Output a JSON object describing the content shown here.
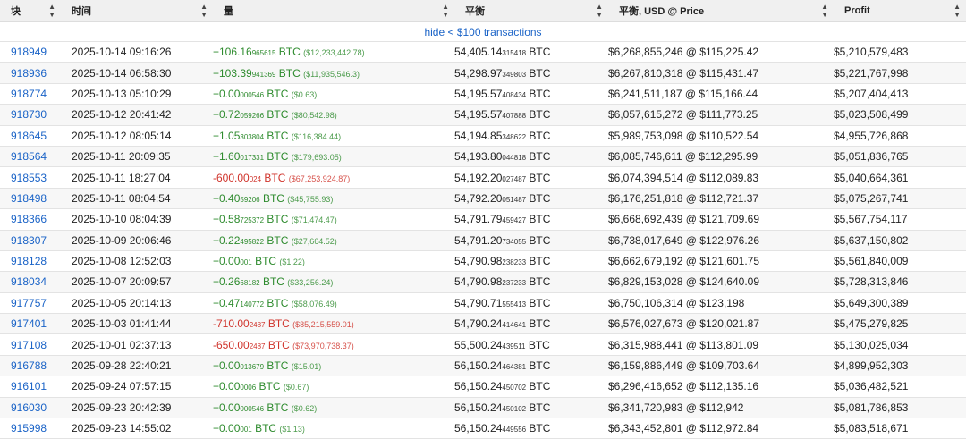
{
  "headers": [
    "块",
    "时间",
    "量",
    "平衡",
    "平衡, USD @ Price",
    "Profit"
  ],
  "toggle_label": "hide < $100 transactions",
  "colors": {
    "positive": "#2e8b2e",
    "negative": "#d0342c",
    "link": "#1a63c7"
  },
  "rows": [
    {
      "block": "918949",
      "time": "2025-10-14 09:16:26",
      "sign": "pos",
      "amt_main": "+106.16",
      "amt_small": "965615",
      "amt_unit": " BTC ",
      "amt_usd": "($12,233,442.78)",
      "bal_main": "54,405.14",
      "bal_small": "315418",
      "bal_unit": " BTC",
      "usd_price": "$6,268,855,246 @ $115,225.42",
      "profit": "$5,210,579,483"
    },
    {
      "block": "918936",
      "time": "2025-10-14 06:58:30",
      "sign": "pos",
      "amt_main": "+103.39",
      "amt_small": "941369",
      "amt_unit": " BTC ",
      "amt_usd": "($11,935,546.3)",
      "bal_main": "54,298.97",
      "bal_small": "349803",
      "bal_unit": " BTC",
      "usd_price": "$6,267,810,318 @ $115,431.47",
      "profit": "$5,221,767,998"
    },
    {
      "block": "918774",
      "time": "2025-10-13 05:10:29",
      "sign": "pos",
      "amt_main": "+0.00",
      "amt_small": "000546",
      "amt_unit": " BTC ",
      "amt_usd": "($0.63)",
      "bal_main": "54,195.57",
      "bal_small": "408434",
      "bal_unit": " BTC",
      "usd_price": "$6,241,511,187 @ $115,166.44",
      "profit": "$5,207,404,413"
    },
    {
      "block": "918730",
      "time": "2025-10-12 20:41:42",
      "sign": "pos",
      "amt_main": "+0.72",
      "amt_small": "059266",
      "amt_unit": " BTC ",
      "amt_usd": "($80,542.98)",
      "bal_main": "54,195.57",
      "bal_small": "407888",
      "bal_unit": " BTC",
      "usd_price": "$6,057,615,272 @ $111,773.25",
      "profit": "$5,023,508,499"
    },
    {
      "block": "918645",
      "time": "2025-10-12 08:05:14",
      "sign": "pos",
      "amt_main": "+1.05",
      "amt_small": "303804",
      "amt_unit": " BTC ",
      "amt_usd": "($116,384.44)",
      "bal_main": "54,194.85",
      "bal_small": "348622",
      "bal_unit": " BTC",
      "usd_price": "$5,989,753,098 @ $110,522.54",
      "profit": "$4,955,726,868"
    },
    {
      "block": "918564",
      "time": "2025-10-11 20:09:35",
      "sign": "pos",
      "amt_main": "+1.60",
      "amt_small": "017331",
      "amt_unit": " BTC ",
      "amt_usd": "($179,693.05)",
      "bal_main": "54,193.80",
      "bal_small": "044818",
      "bal_unit": " BTC",
      "usd_price": "$6,085,746,611 @ $112,295.99",
      "profit": "$5,051,836,765"
    },
    {
      "block": "918553",
      "time": "2025-10-11 18:27:04",
      "sign": "neg",
      "amt_main": "-600.00",
      "amt_small": "024",
      "amt_unit": " BTC ",
      "amt_usd": "($67,253,924.87)",
      "bal_main": "54,192.20",
      "bal_small": "027487",
      "bal_unit": " BTC",
      "usd_price": "$6,074,394,514 @ $112,089.83",
      "profit": "$5,040,664,361"
    },
    {
      "block": "918498",
      "time": "2025-10-11 08:04:54",
      "sign": "pos",
      "amt_main": "+0.40",
      "amt_small": "59206",
      "amt_unit": " BTC ",
      "amt_usd": "($45,755.93)",
      "bal_main": "54,792.20",
      "bal_small": "051487",
      "bal_unit": " BTC",
      "usd_price": "$6,176,251,818 @ $112,721.37",
      "profit": "$5,075,267,741"
    },
    {
      "block": "918366",
      "time": "2025-10-10 08:04:39",
      "sign": "pos",
      "amt_main": "+0.58",
      "amt_small": "725372",
      "amt_unit": " BTC ",
      "amt_usd": "($71,474.47)",
      "bal_main": "54,791.79",
      "bal_small": "459427",
      "bal_unit": " BTC",
      "usd_price": "$6,668,692,439 @ $121,709.69",
      "profit": "$5,567,754,117"
    },
    {
      "block": "918307",
      "time": "2025-10-09 20:06:46",
      "sign": "pos",
      "amt_main": "+0.22",
      "amt_small": "495822",
      "amt_unit": " BTC ",
      "amt_usd": "($27,664.52)",
      "bal_main": "54,791.20",
      "bal_small": "734055",
      "bal_unit": " BTC",
      "usd_price": "$6,738,017,649 @ $122,976.26",
      "profit": "$5,637,150,802"
    },
    {
      "block": "918128",
      "time": "2025-10-08 12:52:03",
      "sign": "pos",
      "amt_main": "+0.00",
      "amt_small": "001",
      "amt_unit": " BTC ",
      "amt_usd": "($1.22)",
      "bal_main": "54,790.98",
      "bal_small": "238233",
      "bal_unit": " BTC",
      "usd_price": "$6,662,679,192 @ $121,601.75",
      "profit": "$5,561,840,009"
    },
    {
      "block": "918034",
      "time": "2025-10-07 20:09:57",
      "sign": "pos",
      "amt_main": "+0.26",
      "amt_small": "68182",
      "amt_unit": " BTC ",
      "amt_usd": "($33,256.24)",
      "bal_main": "54,790.98",
      "bal_small": "237233",
      "bal_unit": " BTC",
      "usd_price": "$6,829,153,028 @ $124,640.09",
      "profit": "$5,728,313,846"
    },
    {
      "block": "917757",
      "time": "2025-10-05 20:14:13",
      "sign": "pos",
      "amt_main": "+0.47",
      "amt_small": "140772",
      "amt_unit": " BTC ",
      "amt_usd": "($58,076.49)",
      "bal_main": "54,790.71",
      "bal_small": "555413",
      "bal_unit": " BTC",
      "usd_price": "$6,750,106,314 @ $123,198",
      "profit": "$5,649,300,389"
    },
    {
      "block": "917401",
      "time": "2025-10-03 01:41:44",
      "sign": "neg",
      "amt_main": "-710.00",
      "amt_small": "2487",
      "amt_unit": " BTC ",
      "amt_usd": "($85,215,559.01)",
      "bal_main": "54,790.24",
      "bal_small": "414641",
      "bal_unit": " BTC",
      "usd_price": "$6,576,027,673 @ $120,021.87",
      "profit": "$5,475,279,825"
    },
    {
      "block": "917108",
      "time": "2025-10-01 02:37:13",
      "sign": "neg",
      "amt_main": "-650.00",
      "amt_small": "2487",
      "amt_unit": " BTC ",
      "amt_usd": "($73,970,738.37)",
      "bal_main": "55,500.24",
      "bal_small": "439511",
      "bal_unit": " BTC",
      "usd_price": "$6,315,988,441 @ $113,801.09",
      "profit": "$5,130,025,034"
    },
    {
      "block": "916788",
      "time": "2025-09-28 22:40:21",
      "sign": "pos",
      "amt_main": "+0.00",
      "amt_small": "013679",
      "amt_unit": " BTC ",
      "amt_usd": "($15.01)",
      "bal_main": "56,150.24",
      "bal_small": "464381",
      "bal_unit": " BTC",
      "usd_price": "$6,159,886,449 @ $109,703.64",
      "profit": "$4,899,952,303"
    },
    {
      "block": "916101",
      "time": "2025-09-24 07:57:15",
      "sign": "pos",
      "amt_main": "+0.00",
      "amt_small": "0006",
      "amt_unit": " BTC ",
      "amt_usd": "($0.67)",
      "bal_main": "56,150.24",
      "bal_small": "450702",
      "bal_unit": " BTC",
      "usd_price": "$6,296,416,652 @ $112,135.16",
      "profit": "$5,036,482,521"
    },
    {
      "block": "916030",
      "time": "2025-09-23 20:42:39",
      "sign": "pos",
      "amt_main": "+0.00",
      "amt_small": "000546",
      "amt_unit": " BTC ",
      "amt_usd": "($0.62)",
      "bal_main": "56,150.24",
      "bal_small": "450102",
      "bal_unit": " BTC",
      "usd_price": "$6,341,720,983 @ $112,942",
      "profit": "$5,081,786,853"
    },
    {
      "block": "915998",
      "time": "2025-09-23 14:55:02",
      "sign": "pos",
      "amt_main": "+0.00",
      "amt_small": "001",
      "amt_unit": " BTC ",
      "amt_usd": "($1.13)",
      "bal_main": "56,150.24",
      "bal_small": "449556",
      "bal_unit": " BTC",
      "usd_price": "$6,343,452,801 @ $112,972.84",
      "profit": "$5,083,518,671"
    }
  ]
}
